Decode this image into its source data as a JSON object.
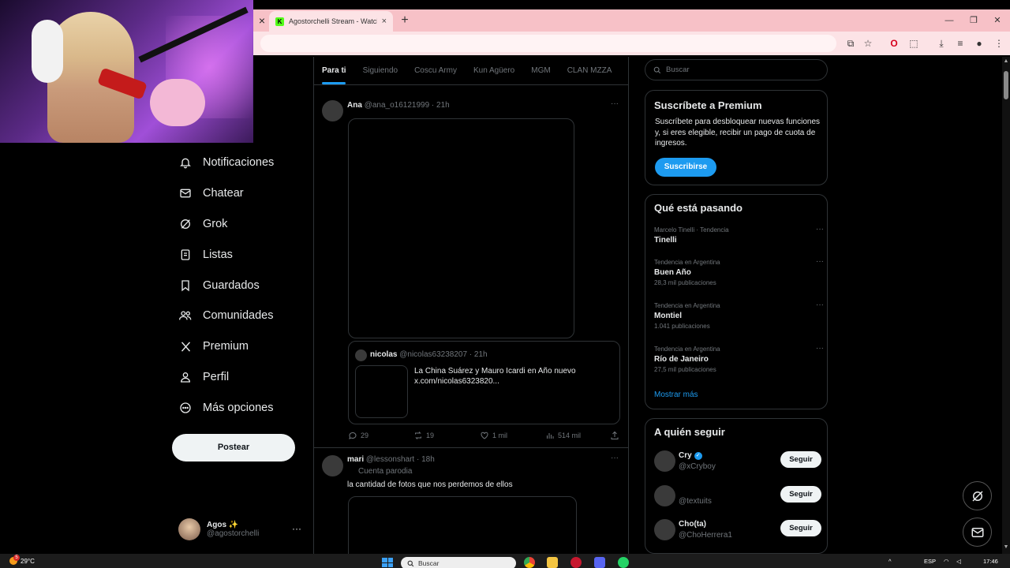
{
  "browser": {
    "tab_title": "Agostorchelli Stream - Watch Li",
    "tab_close": "×",
    "new_tab": "+",
    "left_close": "×"
  },
  "center_tabs": [
    "Para ti",
    "Siguiendo",
    "Coscu Army",
    "Kun Agüero",
    "MGM",
    "CLAN MZZA"
  ],
  "nav": {
    "items": [
      {
        "label": "Notificaciones",
        "icon": "bell-icon"
      },
      {
        "label": "Chatear",
        "icon": "mail-icon"
      },
      {
        "label": "Grok",
        "icon": "grok-icon"
      },
      {
        "label": "Listas",
        "icon": "list-icon"
      },
      {
        "label": "Guardados",
        "icon": "bookmark-icon"
      },
      {
        "label": "Comunidades",
        "icon": "people-icon"
      },
      {
        "label": "Premium",
        "icon": "x-logo-icon"
      },
      {
        "label": "Perfil",
        "icon": "person-icon"
      },
      {
        "label": "Más opciones",
        "icon": "more-circle-icon"
      }
    ],
    "post_label": "Postear"
  },
  "account": {
    "name": "Agos ✨",
    "handle": "@agostorchelli",
    "more": "···"
  },
  "tweets": [
    {
      "name": "Ana",
      "handle": "@ana_o16121999",
      "time": "· 21h",
      "quote": {
        "name": "nicolas",
        "handle": "@nicolas63238207",
        "time": "· 21h",
        "text": "La China Suárez y Mauro Icardi en Año nuevo x.com/nicolas6323820..."
      },
      "replies": "29",
      "reposts": "19",
      "likes": "1 mil",
      "views": "514 mil"
    },
    {
      "name": "mari",
      "handle": "@lessonshart",
      "time": "· 18h",
      "label": "Cuenta parodia",
      "text": "la cantidad de fotos que nos perdemos de ellos"
    }
  ],
  "search": {
    "placeholder": "Buscar"
  },
  "premium": {
    "title": "Suscríbete a Premium",
    "desc": "Suscríbete para desbloquear nuevas funciones y, si eres elegible, recibir un pago de cuota de ingresos.",
    "button": "Suscribirse"
  },
  "trends": {
    "title": "Qué está pasando",
    "items": [
      {
        "context": "Marcelo Tinelli · Tendencia",
        "name": "Tinelli",
        "count": ""
      },
      {
        "context": "Tendencia en Argentina",
        "name": "Buen Año",
        "count": "28,3 mil publicaciones"
      },
      {
        "context": "Tendencia en Argentina",
        "name": "Montiel",
        "count": "1.041 publicaciones"
      },
      {
        "context": "Tendencia en Argentina",
        "name": "Río de Janeiro",
        "count": "27,5 mil publicaciones"
      }
    ],
    "show_more": "Mostrar más"
  },
  "who_to_follow": {
    "title": "A quién seguir",
    "items": [
      {
        "name": "Cry",
        "handle": "@xCryboy",
        "verified": true,
        "button": "Seguir"
      },
      {
        "name": "",
        "handle": "@textuits",
        "verified": false,
        "button": "Seguir"
      },
      {
        "name": "Cho(ta)",
        "handle": "@ChoHerrera1",
        "verified": false,
        "button": "Seguir"
      }
    ]
  },
  "taskbar": {
    "temp": "29°C",
    "weather_badge": "5",
    "search": "Buscar",
    "lang": "ESP",
    "time": "17:46"
  },
  "colors": {
    "accent": "#1d9bf0",
    "tabstrip": "#f7c1c7",
    "background": "#000000"
  }
}
